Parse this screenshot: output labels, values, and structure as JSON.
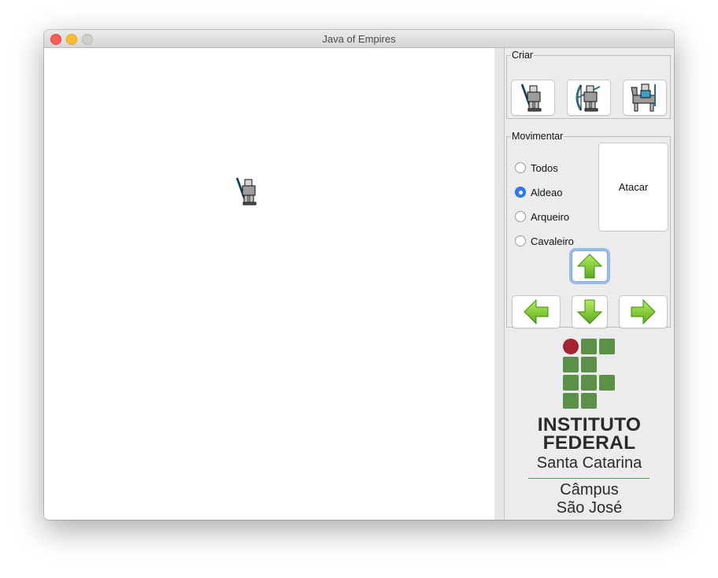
{
  "window": {
    "title": "Java of Empires"
  },
  "canvas": {
    "units": [
      {
        "icon": "villager-sprite-icon"
      }
    ]
  },
  "criar": {
    "legend": "Criar",
    "buttons": [
      {
        "icon": "villager-icon"
      },
      {
        "icon": "archer-icon"
      },
      {
        "icon": "knight-icon"
      }
    ]
  },
  "movimentar": {
    "legend": "Movimentar",
    "options": [
      {
        "label": "Todos",
        "checked": false
      },
      {
        "label": "Aldeao",
        "checked": true
      },
      {
        "label": "Arqueiro",
        "checked": false
      },
      {
        "label": "Cavaleiro",
        "checked": false
      }
    ],
    "attack_label": "Atacar",
    "arrows": [
      "arrow-up-icon",
      "arrow-left-icon",
      "arrow-down-icon",
      "arrow-right-icon"
    ]
  },
  "logo": {
    "line1": "INSTITUTO",
    "line2": "FEDERAL",
    "line3": "Santa Catarina",
    "line4": "Câmpus",
    "line5": "São José",
    "colors": {
      "red": "#a32430",
      "green": "#5a9048",
      "text": "#2a2a2a"
    }
  }
}
